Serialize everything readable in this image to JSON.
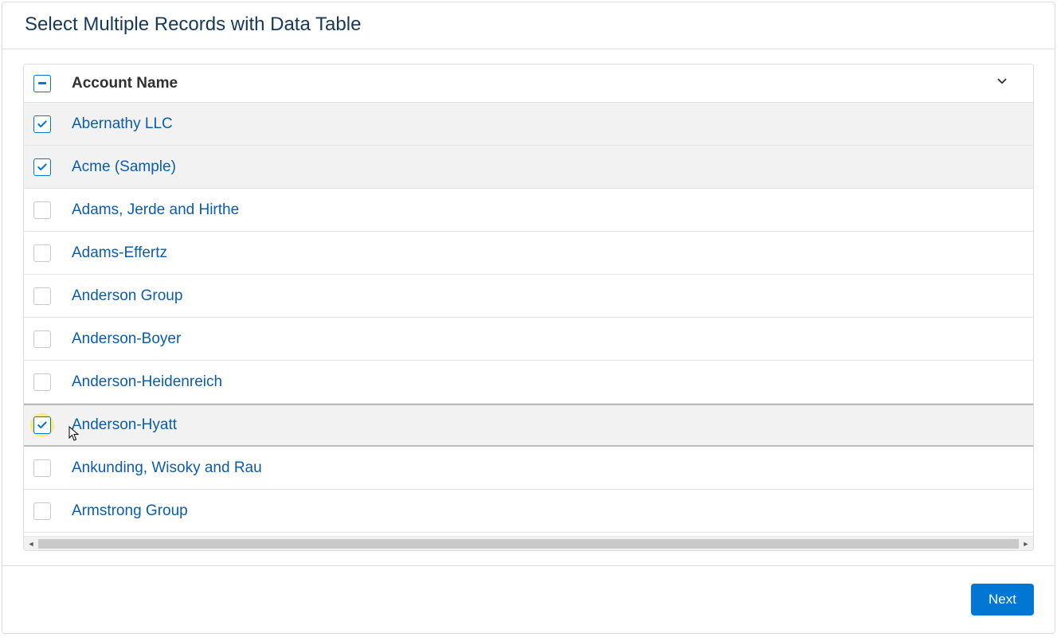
{
  "page": {
    "title": "Select Multiple Records with Data Table"
  },
  "table": {
    "column_header": "Account Name",
    "select_all_state": "indeterminate",
    "rows": [
      {
        "name": "Abernathy LLC",
        "checked": true,
        "hovered": false,
        "highlighted": false
      },
      {
        "name": "Acme (Sample)",
        "checked": true,
        "hovered": false,
        "highlighted": false
      },
      {
        "name": "Adams, Jerde and Hirthe",
        "checked": false,
        "hovered": false,
        "highlighted": false
      },
      {
        "name": "Adams-Effertz",
        "checked": false,
        "hovered": false,
        "highlighted": false
      },
      {
        "name": "Anderson Group",
        "checked": false,
        "hovered": false,
        "highlighted": false
      },
      {
        "name": "Anderson-Boyer",
        "checked": false,
        "hovered": false,
        "highlighted": false
      },
      {
        "name": "Anderson-Heidenreich",
        "checked": false,
        "hovered": false,
        "highlighted": false
      },
      {
        "name": "Anderson-Hyatt",
        "checked": true,
        "hovered": true,
        "highlighted": true
      },
      {
        "name": "Ankunding, Wisoky and Rau",
        "checked": false,
        "hovered": false,
        "highlighted": false
      },
      {
        "name": "Armstrong Group",
        "checked": false,
        "hovered": false,
        "highlighted": false
      }
    ]
  },
  "footer": {
    "next_label": "Next"
  }
}
